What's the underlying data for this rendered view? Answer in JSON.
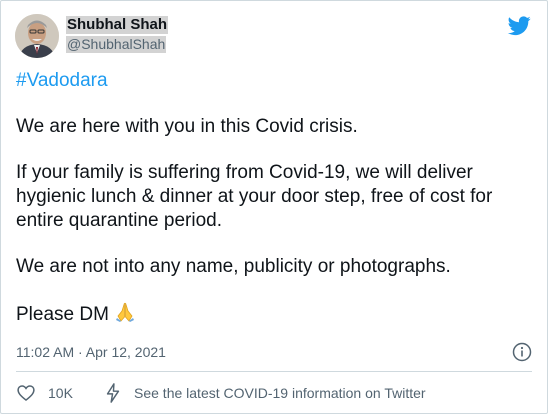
{
  "author": {
    "display_name": "Shubhal Shah",
    "handle": "@ShubhalShah"
  },
  "icons": {
    "brand": "twitter-bird-icon",
    "info": "info-icon",
    "like": "heart-icon",
    "covid": "lightning-icon",
    "emoji": "folded-hands-emoji"
  },
  "colors": {
    "link_blue": "#1d9bf0",
    "text": "#0f1419",
    "muted": "#536471",
    "border": "#cfd9de"
  },
  "tweet": {
    "hashtag": "#Vadodara",
    "paragraphs": [
      "We are here with you in this Covid crisis.",
      "If your family is suffering from Covid-19, we will deliver hygienic lunch & dinner at your door step, free of cost for entire quarantine period.",
      "We are not into any name, publicity or photographs."
    ],
    "closing": "Please DM",
    "timestamp": "11:02 AM · Apr 12, 2021"
  },
  "actions": {
    "like_count": "10K",
    "covid_info": "See the latest COVID-19 information on Twitter"
  }
}
